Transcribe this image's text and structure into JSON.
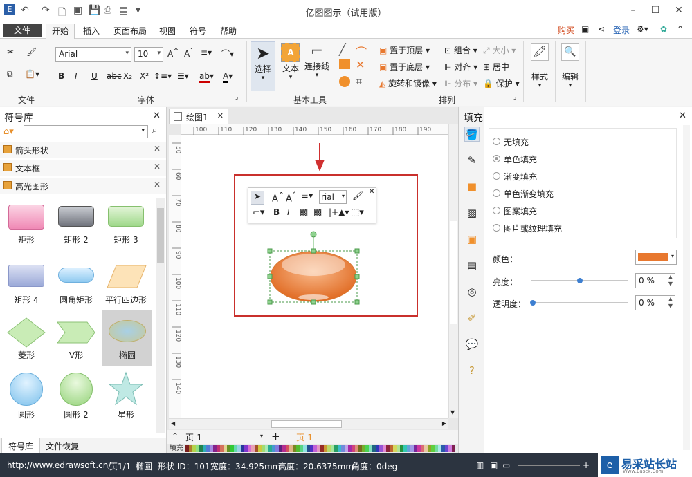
{
  "app": {
    "title": "亿图图示（试用版）"
  },
  "menu": {
    "file": "文件",
    "tabs": [
      "开始",
      "插入",
      "页面布局",
      "视图",
      "符号",
      "帮助"
    ],
    "buy": "购买",
    "login": "登录"
  },
  "ribbon": {
    "font_name": "Arial",
    "font_size": "10",
    "groups": {
      "file": "文件",
      "font": "字体",
      "basic_tools": "基本工具",
      "arrange": "排列"
    },
    "select_label": "选择",
    "text_label": "文本",
    "connector_label": "连接线",
    "bring_front": "置于顶层",
    "send_back": "置于底层",
    "rotate_mirror": "旋转和镜像",
    "group": "组合",
    "align": "对齐",
    "distribute": "分布",
    "size": "大小",
    "center": "居中",
    "protect": "保护",
    "style_label": "样式",
    "edit_label": "编辑"
  },
  "library": {
    "title": "符号库",
    "categories": [
      "箭头形状",
      "文本框",
      "高光图形"
    ],
    "shapes": [
      {
        "label": "矩形"
      },
      {
        "label": "矩形 2"
      },
      {
        "label": "矩形 3"
      },
      {
        "label": "矩形 4"
      },
      {
        "label": "圆角矩形"
      },
      {
        "label": "平行四边形"
      },
      {
        "label": "菱形"
      },
      {
        "label": "V形"
      },
      {
        "label": "椭圆"
      },
      {
        "label": "圆形"
      },
      {
        "label": "圆形 2"
      },
      {
        "label": "星形"
      }
    ],
    "bottom_tabs": [
      "符号库",
      "文件恢复"
    ]
  },
  "canvas": {
    "doc_tab": "绘图1",
    "ruler_top": [
      "100",
      "110",
      "120",
      "130",
      "140",
      "150",
      "160",
      "170",
      "180",
      "190"
    ],
    "ruler_left": [
      "50",
      "60",
      "70",
      "80",
      "90",
      "100",
      "110",
      "120",
      "130",
      "140"
    ],
    "page_name": "页-1",
    "page_tab": "页-1",
    "fill_label": "填充",
    "mini_font": "rial"
  },
  "fill_panel": {
    "title": "填充",
    "options": [
      "无填充",
      "单色填充",
      "渐变填充",
      "单色渐变填充",
      "图案填充",
      "图片或纹理填充"
    ],
    "selected_index": 1,
    "color_label": "颜色：",
    "color_value": "#e8782f",
    "brightness_label": "亮度：",
    "brightness_value": "0 %",
    "brightness_level": 0.5,
    "transparency_label": "透明度：",
    "transparency_value": "0 %"
  },
  "status": {
    "url": "http://www.edrawsoft.cn/",
    "page": "页1/1",
    "shape_name": "椭圆",
    "shape_id": "形状 ID：101",
    "width": "宽度：34.925mm",
    "height": "高度：20.6375mm",
    "angle": "角度：0deg"
  },
  "watermark": {
    "text": "易采站长站",
    "sub": "Www.Easck.Com"
  }
}
